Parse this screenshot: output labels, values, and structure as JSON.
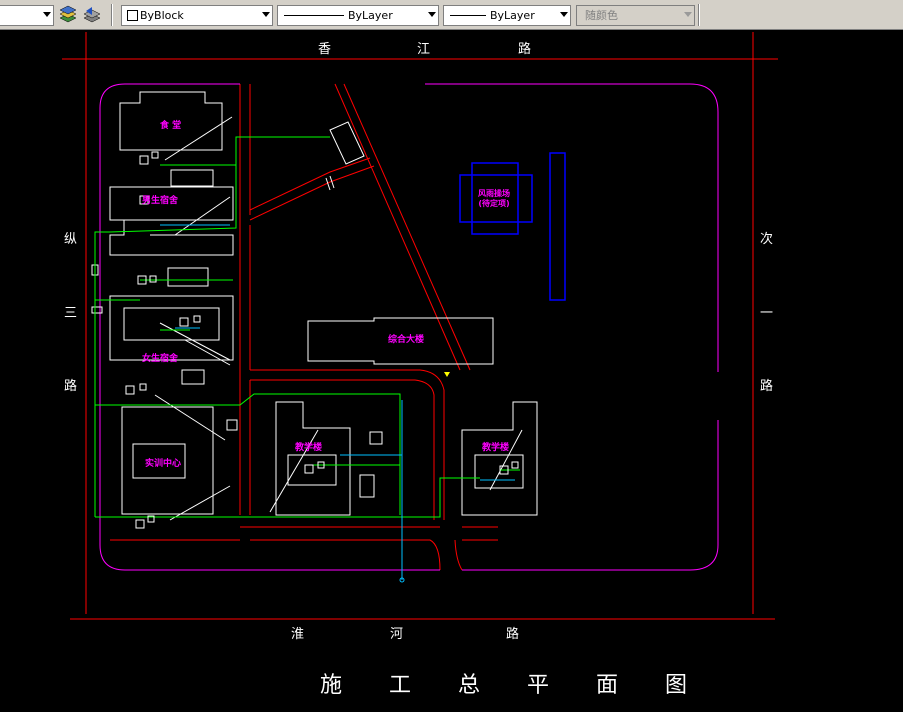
{
  "toolbar": {
    "color_combo": "ByBlock",
    "linetype_combo": "ByLayer",
    "lineweight_combo": "ByLayer",
    "plotstyle_combo": "随颜色"
  },
  "drawing": {
    "title": "施 工 总 平 面 图",
    "roads": {
      "top": [
        "香",
        "江",
        "路"
      ],
      "bottom": [
        "淮",
        "河",
        "路"
      ],
      "left": [
        "纵",
        "三",
        "路"
      ],
      "right": [
        "次",
        "一",
        "路"
      ]
    },
    "buildings": {
      "canteen": "食 堂",
      "male_dorm": "男生宿舍",
      "female_dorm": "女生宿舍",
      "training_center": "实训中心",
      "complex_building": "综合大楼",
      "rain_corridor_line1": "风雨操场",
      "rain_corridor_line2": "(待定项)",
      "teaching_building_1": "教学楼",
      "teaching_building_2": "教学楼"
    },
    "colors": {
      "road_line": "#ff0000",
      "boundary": "#ff00ff",
      "building": "#ffffff",
      "pipe_green": "#00ff00",
      "pipe_cyan": "#00bfff",
      "blue_structure": "#0000ff",
      "marker": "#ffff00"
    }
  }
}
